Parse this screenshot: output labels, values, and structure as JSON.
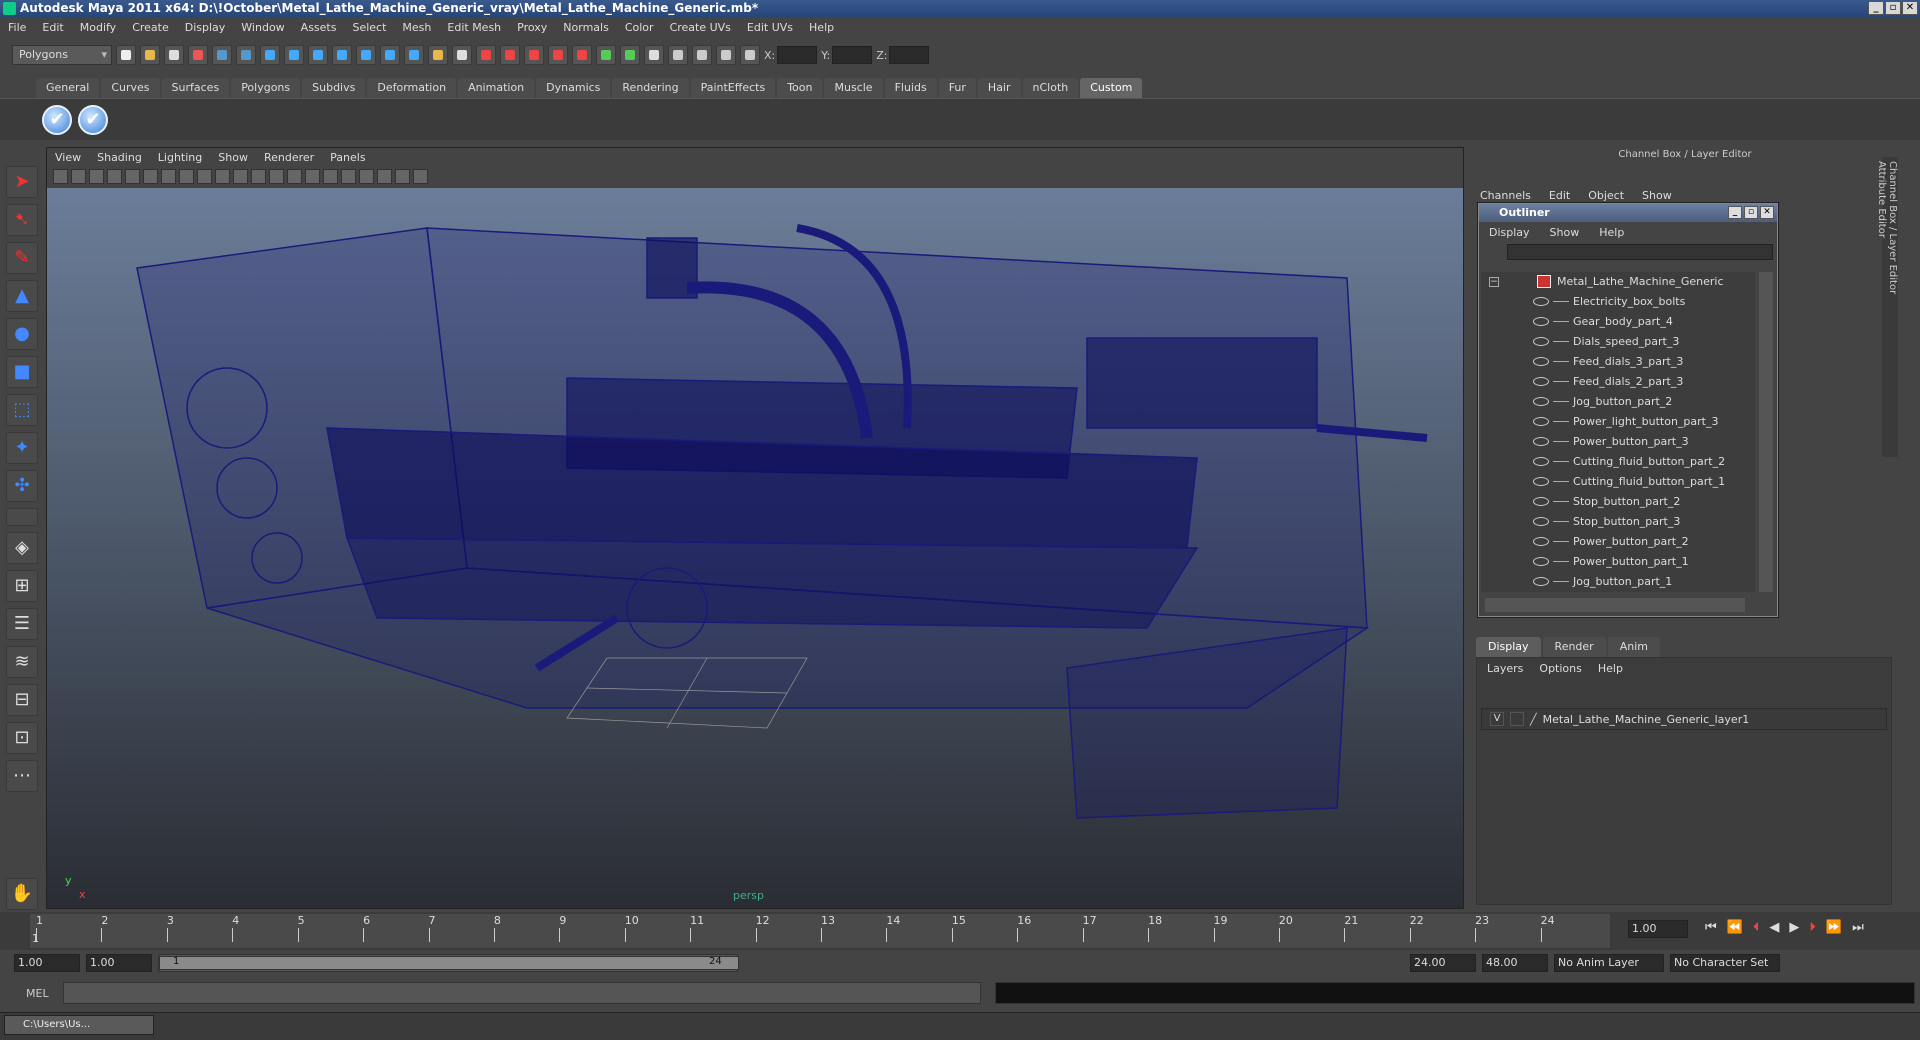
{
  "window": {
    "title": "Autodesk Maya 2011 x64: D:\\!October\\Metal_Lathe_Machine_Generic_vray\\Metal_Lathe_Machine_Generic.mb*"
  },
  "menu": [
    "File",
    "Edit",
    "Modify",
    "Create",
    "Display",
    "Window",
    "Assets",
    "Select",
    "Mesh",
    "Edit Mesh",
    "Proxy",
    "Normals",
    "Color",
    "Create UVs",
    "Edit UVs",
    "Help"
  ],
  "status": {
    "mode": "Polygons",
    "x_label": "X:",
    "y_label": "Y:",
    "z_label": "Z:"
  },
  "shelf_tabs": [
    "General",
    "Curves",
    "Surfaces",
    "Polygons",
    "Subdivs",
    "Deformation",
    "Animation",
    "Dynamics",
    "Rendering",
    "PaintEffects",
    "Toon",
    "Muscle",
    "Fluids",
    "Fur",
    "Hair",
    "nCloth",
    "Custom"
  ],
  "shelf_active": "Custom",
  "viewport": {
    "menu": [
      "View",
      "Shading",
      "Lighting",
      "Show",
      "Renderer",
      "Panels"
    ],
    "camera": "persp",
    "axis_x": "x",
    "axis_y": "y"
  },
  "channel_box": {
    "title": "Channel Box / Layer Editor",
    "menu": [
      "Channels",
      "Edit",
      "Object",
      "Show"
    ],
    "side_tabs": [
      "Channel Box / Layer Editor",
      "Attribute Editor"
    ]
  },
  "outliner": {
    "title": "Outliner",
    "menu": [
      "Display",
      "Show",
      "Help"
    ],
    "root": "Metal_Lathe_Machine_Generic",
    "items": [
      "Electricity_box_bolts",
      "Gear_body_part_4",
      "Dials_speed_part_3",
      "Feed_dials_3_part_3",
      "Feed_dials_2_part_3",
      "Jog_button_part_2",
      "Power_light_button_part_3",
      "Power_button_part_3",
      "Cutting_fluid_button_part_2",
      "Cutting_fluid_button_part_1",
      "Stop_button_part_2",
      "Stop_button_part_3",
      "Power_button_part_2",
      "Power_button_part_1",
      "Jog_button_part_1"
    ]
  },
  "layers": {
    "tabs": [
      "Display",
      "Render",
      "Anim"
    ],
    "active": "Display",
    "menu": [
      "Layers",
      "Options",
      "Help"
    ],
    "visible_flag": "V",
    "layer_name": "Metal_Lathe_Machine_Generic_layer1"
  },
  "timeline": {
    "ticks": [
      "1",
      "2",
      "3",
      "4",
      "5",
      "6",
      "7",
      "8",
      "9",
      "10",
      "11",
      "12",
      "13",
      "14",
      "15",
      "16",
      "17",
      "18",
      "19",
      "20",
      "21",
      "22",
      "23",
      "24"
    ],
    "current_frame": "1.00",
    "current_marker": "1"
  },
  "range": {
    "start": "1.00",
    "playback_start": "1.00",
    "slider_start": "1",
    "slider_end": "24",
    "playback_end": "24.00",
    "end": "48.00",
    "anim_layer": "No Anim Layer",
    "char_set": "No Character Set"
  },
  "mel": {
    "label": "MEL"
  },
  "taskbar": {
    "label": "C:\\Users\\Us..."
  }
}
